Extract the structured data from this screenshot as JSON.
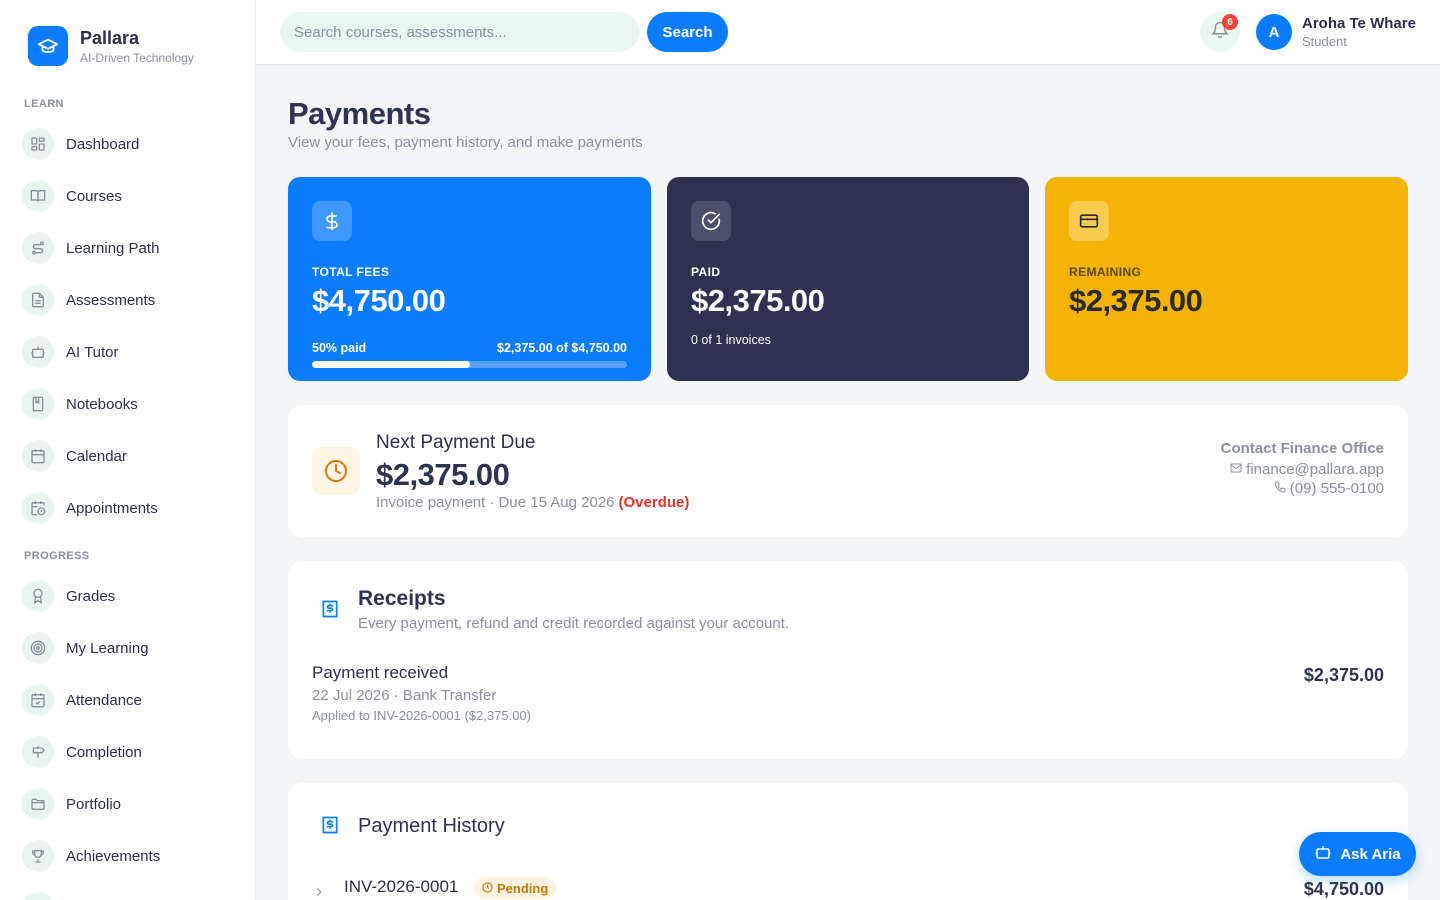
{
  "brand": {
    "name": "Pallara",
    "tagline": "AI-Driven Technology"
  },
  "sidebar": {
    "sections": [
      {
        "label": "LEARN",
        "items": [
          {
            "label": "Dashboard",
            "icon": "grid-icon"
          },
          {
            "label": "Courses",
            "icon": "book-open-icon"
          },
          {
            "label": "Learning Path",
            "icon": "route-icon"
          },
          {
            "label": "Assessments",
            "icon": "file-text-icon"
          },
          {
            "label": "AI Tutor",
            "icon": "bot-icon"
          },
          {
            "label": "Notebooks",
            "icon": "notebook-icon"
          },
          {
            "label": "Calendar",
            "icon": "calendar-icon"
          },
          {
            "label": "Appointments",
            "icon": "calendar-clock-icon"
          }
        ]
      },
      {
        "label": "PROGRESS",
        "items": [
          {
            "label": "Grades",
            "icon": "award-icon"
          },
          {
            "label": "My Learning",
            "icon": "target-icon"
          },
          {
            "label": "Attendance",
            "icon": "calendar-check-icon"
          },
          {
            "label": "Completion",
            "icon": "signpost-icon"
          },
          {
            "label": "Portfolio",
            "icon": "folder-icon"
          },
          {
            "label": "Achievements",
            "icon": "trophy-icon"
          }
        ]
      }
    ]
  },
  "header": {
    "search_placeholder": "Search courses, assessments...",
    "search_button": "Search",
    "notification_count": "6",
    "user": {
      "initial": "A",
      "name": "Aroha Te Whare",
      "role": "Student"
    }
  },
  "page": {
    "title": "Payments",
    "subtitle": "View your fees, payment history, and make payments"
  },
  "stats": {
    "total": {
      "label": "TOTAL FEES",
      "value": "$4,750.00",
      "progress_label": "50% paid",
      "progress_detail": "$2,375.00 of $4,750.00",
      "progress_fraction": 0.5
    },
    "paid": {
      "label": "PAID",
      "value": "$2,375.00",
      "note": "0 of 1 invoices"
    },
    "remaining": {
      "label": "REMAINING",
      "value": "$2,375.00"
    }
  },
  "next_payment": {
    "title": "Next Payment Due",
    "amount": "$2,375.00",
    "meta": "Invoice payment · Due 15 Aug 2026",
    "status": "(Overdue)",
    "contact": {
      "title": "Contact Finance Office",
      "email": "finance@pallara.app",
      "phone": "(09) 555-0100"
    }
  },
  "receipts": {
    "title": "Receipts",
    "subtitle": "Every payment, refund and credit recorded against your account.",
    "items": [
      {
        "title": "Payment received",
        "meta": "22 Jul 2026 · Bank Transfer",
        "applied": "Applied to INV-2026-0001 ($2,375.00)",
        "amount": "$2,375.00"
      }
    ]
  },
  "history": {
    "title": "Payment History",
    "rows": [
      {
        "invoice": "INV-2026-0001",
        "status": "Pending",
        "amount": "$4,750.00"
      }
    ]
  },
  "assistant": {
    "label": "Ask Aria"
  },
  "colors": {
    "primary": "#0a7cff",
    "navy": "#2e3250",
    "amber": "#f5b305",
    "danger": "#e0342a",
    "pending": "#c77700"
  }
}
